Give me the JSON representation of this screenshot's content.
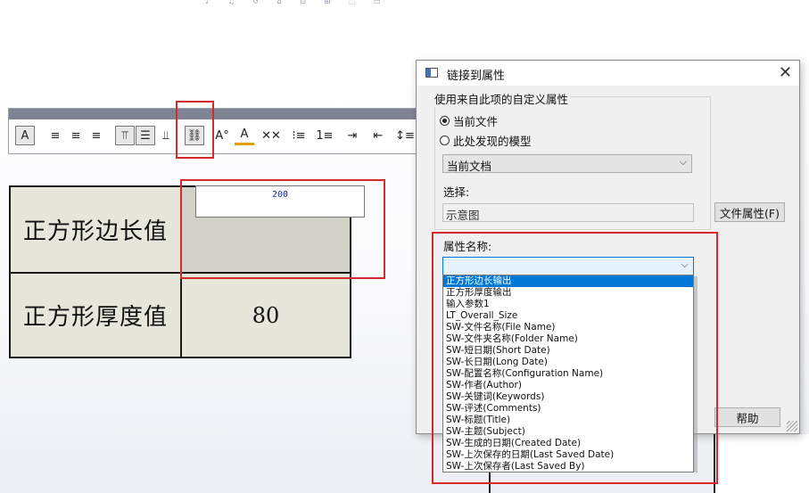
{
  "top_strip_text": "♪ ♫ ↺ ⌂ ⊡ ⊞ ⬚ ▭",
  "toolbar": {
    "buttons": [
      {
        "name": "insert-text-icon",
        "glyph": "A"
      },
      {
        "name": "align-left-icon",
        "glyph": "≡"
      },
      {
        "name": "align-center-icon",
        "glyph": "≡"
      },
      {
        "name": "align-right-icon",
        "glyph": "≡"
      },
      {
        "name": "align-top-icon",
        "glyph": "⫪"
      },
      {
        "name": "align-middle-icon",
        "glyph": "☰"
      },
      {
        "name": "align-bottom-icon",
        "glyph": "⫫"
      },
      {
        "name": "link-property-icon",
        "glyph": "⛓"
      },
      {
        "name": "font-style-icon",
        "glyph": "A°"
      },
      {
        "name": "font-color-icon",
        "glyph": "A"
      },
      {
        "name": "clear-format-icon",
        "glyph": "✕✕"
      },
      {
        "name": "bullet-list-icon",
        "glyph": "⁝≡"
      },
      {
        "name": "numbered-list-icon",
        "glyph": "1≡"
      },
      {
        "name": "indent-increase-icon",
        "glyph": "⇥"
      },
      {
        "name": "indent-decrease-icon",
        "glyph": "⇤"
      },
      {
        "name": "line-spacing-icon",
        "glyph": "↕≡"
      }
    ]
  },
  "table": {
    "rows": [
      {
        "label": "正方形边长值",
        "value": ""
      },
      {
        "label": "正方形厚度值",
        "value": "80"
      }
    ],
    "edit_value": "200"
  },
  "dialog": {
    "title": "链接到属性",
    "close": "✕",
    "group_title": "使用来自此项的自定义属性",
    "radio_current": "当前文件",
    "radio_model": "此处发现的模型",
    "doc_combo": "当前文档",
    "select_label": "选择:",
    "select_value": "示意图",
    "file_props_button": "文件属性(F)",
    "prop_name_label": "属性名称:",
    "help_button": "帮助"
  },
  "dropdown": {
    "items": [
      "正方形边长输出",
      "正方形厚度输出",
      "输入参数1",
      "LT_Overall_Size",
      "SW-文件名称(File Name)",
      "SW-文件夹名称(Folder Name)",
      "SW-短日期(Short Date)",
      "SW-长日期(Long Date)",
      "SW-配置名称(Configuration Name)",
      "SW-作者(Author)",
      "SW-关键词(Keywords)",
      "SW-评述(Comments)",
      "SW-标题(Title)",
      "SW-主题(Subject)",
      "SW-生成的日期(Created Date)",
      "SW-上次保存的日期(Last Saved Date)",
      "SW-上次保存者(Last Saved By)"
    ],
    "selected_index": 0
  },
  "colors": {
    "highlight": "#d62a2a",
    "selection": "#0078d7"
  }
}
